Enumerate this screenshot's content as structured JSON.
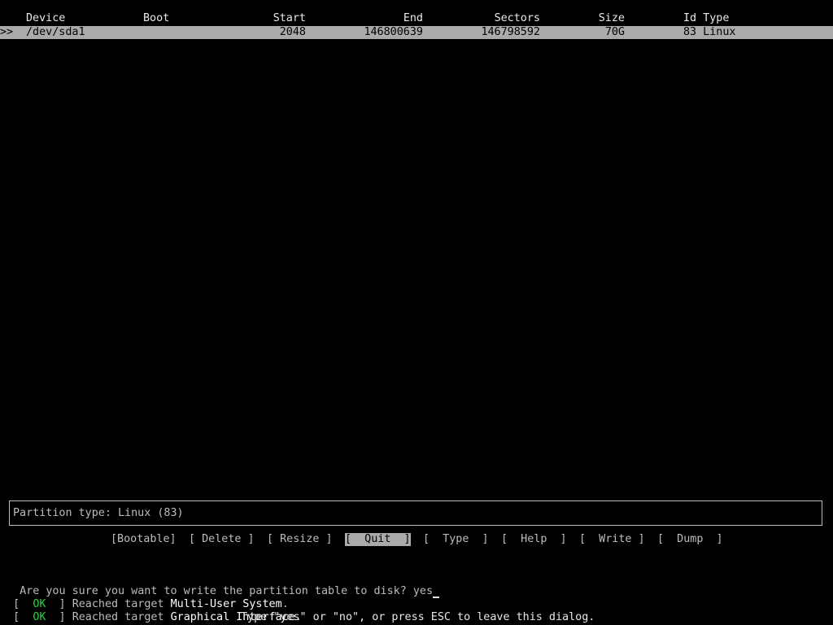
{
  "table": {
    "headers": {
      "device": "Device",
      "boot": "Boot",
      "start": "Start",
      "end": "End",
      "sectors": "Sectors",
      "size": "Size",
      "id_type": "Id Type"
    },
    "rows": [
      {
        "marker": ">>",
        "device": "/dev/sda1",
        "boot": "",
        "start": "2048",
        "end": "146800639",
        "sectors": "146798592",
        "size": "70G",
        "id_type": "83 Linux"
      }
    ]
  },
  "info_box": {
    "text": "Partition type: Linux (83)"
  },
  "menu": {
    "items": [
      {
        "label": "[Bootable]",
        "active": false
      },
      {
        "label": "[ Delete ]",
        "active": false
      },
      {
        "label": "[ Resize ]",
        "active": false
      },
      {
        "label": "[  Quit  ]",
        "active": true
      },
      {
        "label": "[  Type  ]",
        "active": false
      },
      {
        "label": "[  Help  ]",
        "active": false
      },
      {
        "label": "[  Write ]",
        "active": false
      },
      {
        "label": "[  Dump  ]",
        "active": false
      }
    ]
  },
  "prompt": {
    "question": "Are you sure you want to write the partition table to disk? ",
    "answer": "yes"
  },
  "boot_messages": [
    {
      "open": "[  ",
      "status": "OK",
      "close": "  ] ",
      "text": "Reached target ",
      "target": "Multi-User System",
      "end": "."
    },
    {
      "open": "[  ",
      "status": "OK",
      "close": "  ] ",
      "text": "Reached target ",
      "target": "Graphical Interface",
      "end": "."
    }
  ],
  "hint": "Type \"yes\" or \"no\", or press ESC to leave this dialog.",
  "colors": {
    "background": "#000000",
    "text": "#bcbcbc",
    "highlight": "#aaaaaa",
    "ok": "#2ecc40"
  }
}
